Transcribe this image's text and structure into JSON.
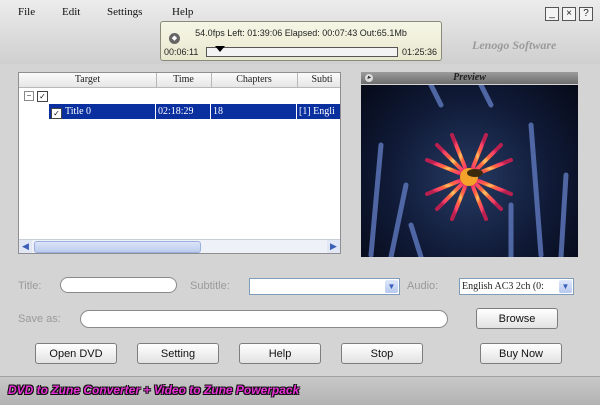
{
  "menu": [
    "File",
    "Edit",
    "Settings",
    "Help"
  ],
  "window_buttons": {
    "minimize": "_",
    "close": "×",
    "help": "?"
  },
  "status": {
    "info": "54.0fps Left: 01:39:06 Elapsed: 00:07:43 Out:65.1Mb",
    "current_time": "00:06:11",
    "total_time": "01:25:36",
    "progress_fraction": 0.07
  },
  "brand": "Lenogo Software",
  "table": {
    "columns": [
      "Target",
      "Time",
      "Chapters",
      "Subti"
    ],
    "row": {
      "target": "Title 0",
      "time": "02:18:29",
      "chapters": "18",
      "subtitle": "[1] Engli"
    }
  },
  "preview_title": "Preview",
  "form": {
    "title_label": "Title:",
    "subtitle_label": "Subtitle:",
    "audio_label": "Audio:",
    "audio_value": "English AC3 2ch (0:",
    "save_as_label": "Save as:"
  },
  "buttons": {
    "browse": "Browse",
    "open_dvd": "Open DVD",
    "setting": "Setting",
    "help": "Help",
    "stop": "Stop",
    "buy_now": "Buy Now"
  },
  "footer_text": "DVD to Zune Converter + Video to Zune Powerpack"
}
